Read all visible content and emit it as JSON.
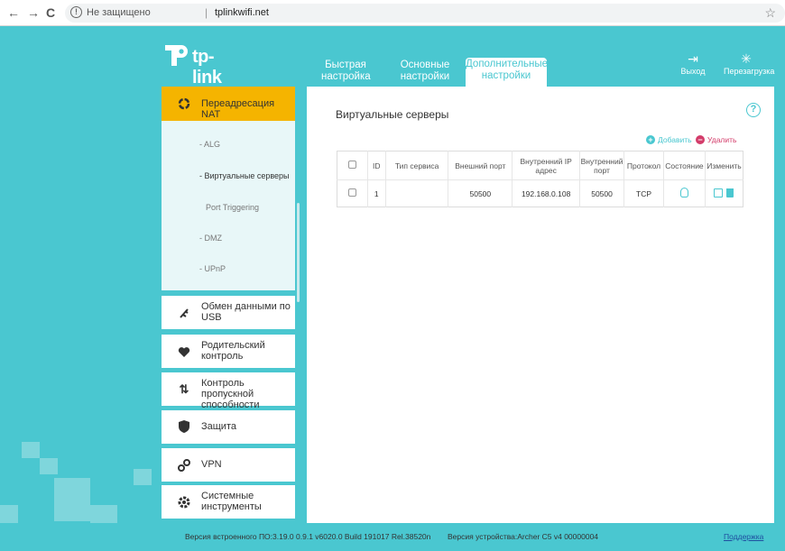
{
  "browser": {
    "back": "←",
    "forward": "→",
    "reload": "C",
    "home": "⌂",
    "security_label": "Не защищено",
    "separator": "|",
    "url": "tplinkwifi.net",
    "bookmark": "☆"
  },
  "header": {
    "brand": "tp-link",
    "tabs": [
      {
        "label": "Быстрая настройка"
      },
      {
        "label": "Основные настройки"
      },
      {
        "label": "Дополнительные настройки"
      }
    ],
    "logout_label": "Выход",
    "reboot_label": "Перезагрузка"
  },
  "sidebar": {
    "nat": {
      "label": "Переадресация NAT",
      "sub_items": [
        {
          "label": "- ALG"
        },
        {
          "label": "- Виртуальные серверы"
        },
        {
          "label": "Port Triggering"
        },
        {
          "label": "- DMZ"
        },
        {
          "label": "- UPnP"
        }
      ]
    },
    "items": [
      {
        "label": "Обмен данными по USB"
      },
      {
        "label": "Родительский контроль"
      },
      {
        "label": "Контроль пропускной способности"
      },
      {
        "label": "Защита"
      },
      {
        "label": "VPN"
      },
      {
        "label": "Системные инструменты"
      }
    ]
  },
  "main": {
    "help": "?",
    "title": "Виртуальные серверы",
    "add_label": "Добавить",
    "delete_label": "Удалить",
    "table": {
      "headers": [
        "ID",
        "Тип сервиса",
        "Внешний порт",
        "Внутренний IP адрес",
        "Внутренний порт",
        "Протокол",
        "Состояние",
        "Изменить"
      ],
      "rows": [
        {
          "id": "1",
          "service": "",
          "ext_port": "50500",
          "int_ip": "192.168.0.108",
          "int_port": "50500",
          "protocol": "TCP"
        }
      ]
    }
  },
  "footer": {
    "firmware": "Версия встроенного ПО:3.19.0 0.9.1 v6020.0 Build 191017 Rel.38520n",
    "hardware": "Версия устройства:Archer C5 v4 00000004",
    "support": "Поддержка"
  },
  "colors": {
    "background": "#4ac7d0",
    "accent_active": "#f5b400",
    "delete": "#d33c6a",
    "link": "#1f4fa0"
  }
}
